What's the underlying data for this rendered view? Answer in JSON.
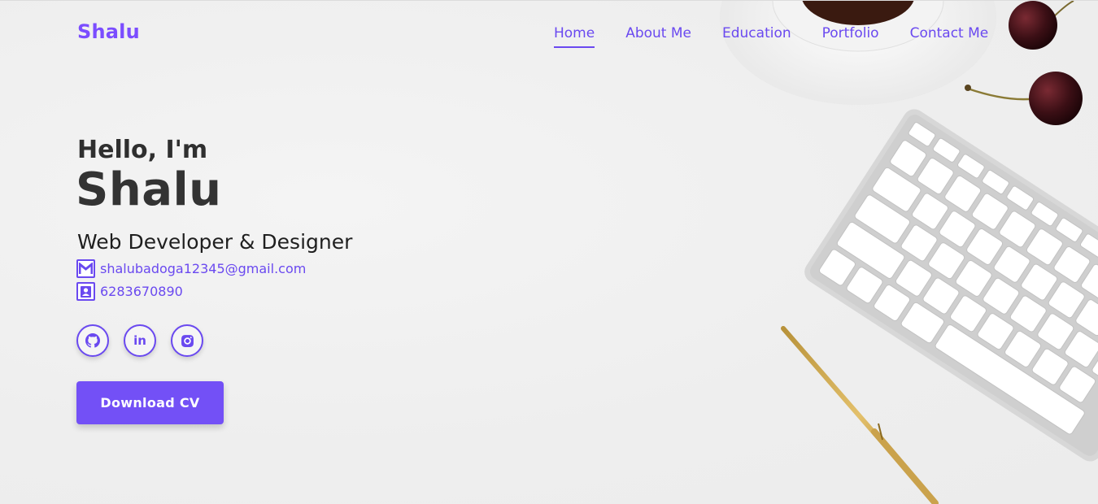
{
  "header": {
    "logo": "Shalu",
    "nav": [
      {
        "label": "Home",
        "active": true
      },
      {
        "label": "About Me",
        "active": false
      },
      {
        "label": "Education",
        "active": false
      },
      {
        "label": "Portfolio",
        "active": false
      },
      {
        "label": "Contact Me",
        "active": false
      }
    ]
  },
  "hero": {
    "greeting": "Hello, I'm",
    "name": "Shalu",
    "role": "Web Developer & Designer",
    "email": "shalubadoga12345@gmail.com",
    "phone": "6283670890",
    "email_icon": "gmail-icon",
    "phone_icon": "contact-book-icon"
  },
  "socials": [
    {
      "name": "github-icon"
    },
    {
      "name": "linkedin-icon",
      "glyph": "in"
    },
    {
      "name": "instagram-icon"
    }
  ],
  "cta": {
    "label": "Download CV"
  },
  "colors": {
    "accent": "#7350f6",
    "text_dark": "#333333",
    "background": "#efefef"
  }
}
